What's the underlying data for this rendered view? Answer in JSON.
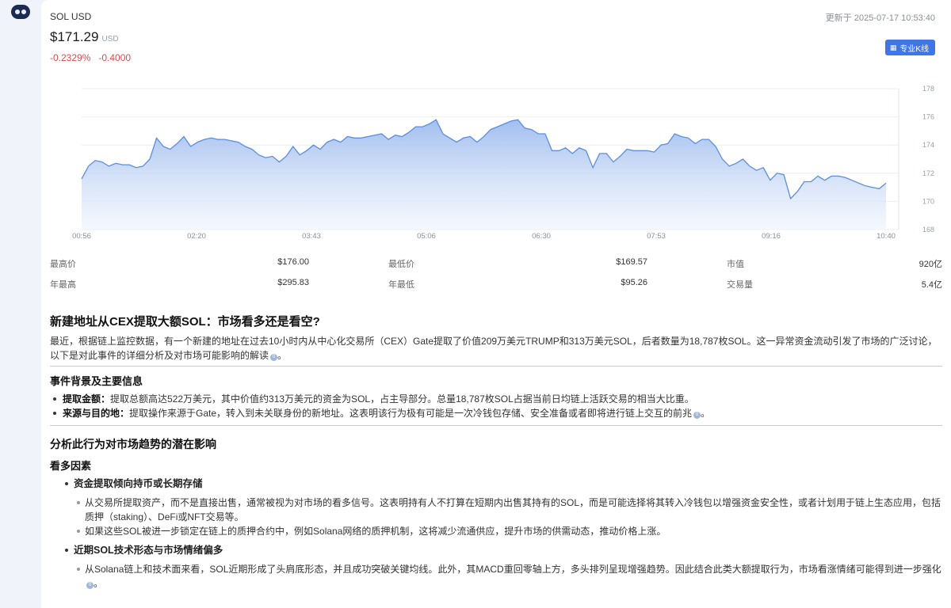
{
  "quote": {
    "symbol": "SOL USD",
    "updated": "更新于 2025-07-17 10:53:40",
    "price": "$171.29",
    "unit": "USD",
    "change_pct": "-0.2329%",
    "change_abs": "-0.4000",
    "pro_button": "专业K线",
    "pro_icon": "chart-icon"
  },
  "colors": {
    "line": "#5b8ee0",
    "fill_top": "#9dbbee",
    "fill_bottom": "#eef3fc",
    "down": "#e04a4a",
    "accent": "#3f76e4"
  },
  "chart_data": {
    "type": "area",
    "x_ticks": [
      "00:56",
      "02:20",
      "03:43",
      "05:06",
      "06:30",
      "07:53",
      "09:16",
      "10:40"
    ],
    "ylim": [
      168,
      178
    ],
    "y_ticks": [
      168,
      170,
      172,
      174,
      176,
      178
    ],
    "values": [
      171.6,
      172.5,
      172.9,
      172.8,
      172.5,
      172.7,
      172.6,
      172.6,
      172.4,
      172.5,
      173.0,
      174.5,
      173.9,
      173.7,
      174.1,
      174.6,
      173.9,
      174.2,
      174.4,
      174.5,
      174.4,
      174.4,
      174.3,
      174.2,
      173.9,
      173.7,
      173.3,
      173.1,
      173.2,
      172.8,
      173.2,
      173.9,
      173.3,
      173.6,
      174.0,
      173.7,
      174.2,
      174.4,
      174.2,
      174.6,
      174.5,
      174.5,
      174.6,
      174.7,
      174.8,
      174.4,
      174.7,
      174.6,
      174.9,
      175.3,
      175.3,
      175.5,
      175.8,
      174.8,
      174.5,
      174.2,
      174.5,
      174.6,
      174.2,
      174.6,
      175.1,
      175.3,
      175.5,
      175.7,
      175.8,
      175.2,
      175.1,
      174.8,
      174.8,
      173.6,
      173.6,
      173.8,
      173.4,
      173.8,
      173.6,
      172.4,
      173.4,
      173.4,
      172.8,
      173.2,
      173.7,
      173.6,
      173.6,
      173.6,
      173.5,
      174.0,
      174.1,
      174.8,
      174.6,
      174.5,
      174.1,
      174.4,
      174.4,
      173.9,
      173.0,
      172.5,
      172.7,
      173.0,
      172.5,
      172.2,
      172.4,
      171.5,
      172.0,
      171.9,
      170.2,
      170.7,
      171.4,
      171.4,
      171.8,
      171.5,
      171.8,
      171.8,
      171.7,
      171.5,
      171.3,
      171.1,
      171.0,
      170.9,
      171.3
    ]
  },
  "stats": [
    [
      {
        "k": "最高价",
        "v": "$176.00"
      },
      {
        "k": "最低价",
        "v": "$169.57"
      },
      {
        "k": "市值",
        "v": "920亿"
      }
    ],
    [
      {
        "k": "年最高",
        "v": "$295.83"
      },
      {
        "k": "年最低",
        "v": "$95.26"
      },
      {
        "k": "交易量",
        "v": "5.4亿"
      }
    ]
  ],
  "article": {
    "title": "新建地址从CEX提取大额SOL：市场看多还是看空?",
    "intro": "最近，根据链上监控数据，有一个新建的地址在过去10小时内从中心化交易所（CEX）Gate提取了价值209万美元TRUMP和313万美元SOL，后者数量为18,787枚SOL。这一异常资金流动引发了市场的广泛讨论，以下是对此事件的详细分析及对市场可能影响的解读",
    "bg_title": "事件背景及主要信息",
    "bg_items": [
      {
        "label": "提取金额：",
        "text": "提取总额高达522万美元，其中价值约313万美元的资金为SOL，占主导部分。总量18,787枚SOL占据当前日均链上活跃交易的相当大比重。"
      },
      {
        "label": "来源与目的地：",
        "text": "提取操作来源于Gate，转入到未关联身份的新地址。这表明该行为极有可能是一次冷钱包存储、安全准备或者即将进行链上交互的前兆"
      }
    ],
    "analysis_title": "分析此行为对市场趋势的潜在影响",
    "bull_title": "看多因素",
    "bull_sub1": "资金提取倾向持币或长期存储",
    "bull_sub1_items": [
      "从交易所提取资产，而不是直接出售，通常被视为对市场的看多信号。这表明持有人不打算在短期内出售其持有的SOL，而是可能选择将其转入冷钱包以增强资金安全性，或者计划用于链上生态应用，包括质押（staking）、DeFi或NFT交易等。",
      "如果这些SOL被进一步锁定在链上的质押合约中，例如Solana网络的质押机制，这将减少流通供应，提升市场的供需动态，推动价格上涨。"
    ],
    "bull_sub2": "近期SOL技术形态与市场情绪偏多",
    "bull_sub2_items": [
      "从Solana链上和技术面来看，SOL近期形成了头肩底形态，并且成功突破关键均线。此外，其MACD重回零轴上方，多头排列呈现增强趋势。因此结合此类大额提取行为，市场看涨情绪可能得到进一步强化"
    ],
    "cite": "0"
  }
}
